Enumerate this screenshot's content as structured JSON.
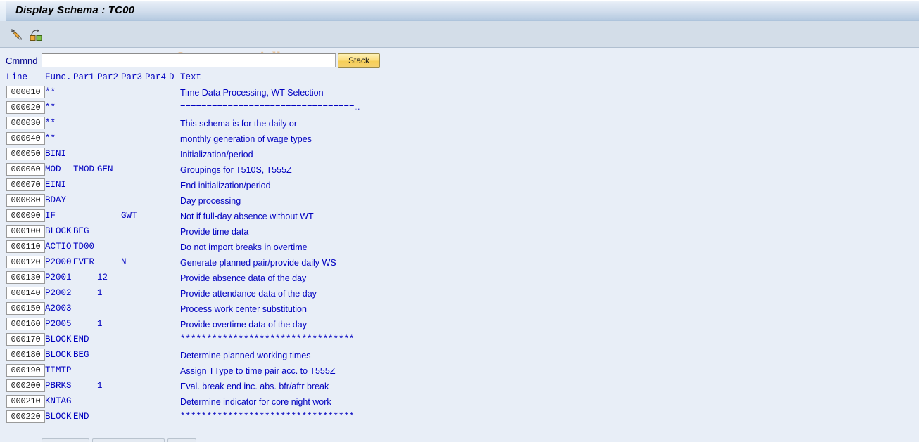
{
  "window": {
    "title": "Display Schema : TC00"
  },
  "toolbar": {
    "icons": [
      {
        "name": "edit-pencil-icon",
        "label": "Change"
      },
      {
        "name": "navigate-graph-icon",
        "label": "Display Structure"
      }
    ]
  },
  "watermark": {
    "text": "© www.tutorialkart.com",
    "color": "#e7c49c"
  },
  "command": {
    "label": "Cmmnd",
    "value": "",
    "placeholder": "",
    "stack_label": "Stack"
  },
  "columns": {
    "line": "Line",
    "func": "Func.",
    "par1": "Par1",
    "par2": "Par2",
    "par3": "Par3",
    "par4": "Par4",
    "d": "D",
    "text": "Text"
  },
  "colors": {
    "titlebar_text": "#000000",
    "grid_text": "#0000c0",
    "label_text": "#00008b",
    "line_number_text": "#222222",
    "stack_button": "#f6cf57",
    "background": "#e8eef7"
  },
  "rows": [
    {
      "line": "000010",
      "func": "**",
      "par1": "",
      "par2": "",
      "par3": "",
      "par4": "",
      "d": "",
      "text": "Time Data Processing, WT Selection",
      "mono": false
    },
    {
      "line": "000020",
      "func": "**",
      "par1": "",
      "par2": "",
      "par3": "",
      "par4": "",
      "d": "",
      "text": "=================================…",
      "mono": true
    },
    {
      "line": "000030",
      "func": "**",
      "par1": "",
      "par2": "",
      "par3": "",
      "par4": "",
      "d": "",
      "text": "This schema is for the daily or",
      "mono": false
    },
    {
      "line": "000040",
      "func": "**",
      "par1": "",
      "par2": "",
      "par3": "",
      "par4": "",
      "d": "",
      "text": "monthly generation of wage types",
      "mono": false
    },
    {
      "line": "000050",
      "func": "BINI",
      "par1": "",
      "par2": "",
      "par3": "",
      "par4": "",
      "d": "",
      "text": "Initialization/period",
      "mono": false
    },
    {
      "line": "000060",
      "func": "MOD",
      "par1": "TMOD",
      "par2": "GEN",
      "par3": "",
      "par4": "",
      "d": "",
      "text": "Groupings for T510S, T555Z",
      "mono": false
    },
    {
      "line": "000070",
      "func": "EINI",
      "par1": "",
      "par2": "",
      "par3": "",
      "par4": "",
      "d": "",
      "text": "End initialization/period",
      "mono": false
    },
    {
      "line": "000080",
      "func": "BDAY",
      "par1": "",
      "par2": "",
      "par3": "",
      "par4": "",
      "d": "",
      "text": "Day processing",
      "mono": false
    },
    {
      "line": "000090",
      "func": "IF",
      "par1": "",
      "par2": "",
      "par3": "GWT",
      "par4": "",
      "d": "",
      "text": "Not if full-day absence without WT",
      "mono": false
    },
    {
      "line": "000100",
      "func": "BLOCK",
      "par1": "BEG",
      "par2": "",
      "par3": "",
      "par4": "",
      "d": "",
      "text": "Provide time data",
      "mono": false
    },
    {
      "line": "000110",
      "func": "ACTIO",
      "par1": "TD00",
      "par2": "",
      "par3": "",
      "par4": "",
      "d": "",
      "text": "Do not import breaks in overtime",
      "mono": false
    },
    {
      "line": "000120",
      "func": "P2000",
      "par1": "EVER",
      "par2": "",
      "par3": "N",
      "par4": "",
      "d": "",
      "text": "Generate planned pair/provide daily WS",
      "mono": false
    },
    {
      "line": "000130",
      "func": "P2001",
      "par1": "",
      "par2": "12",
      "par3": "",
      "par4": "",
      "d": "",
      "text": "Provide absence data of the day",
      "mono": false
    },
    {
      "line": "000140",
      "func": "P2002",
      "par1": "",
      "par2": "1",
      "par3": "",
      "par4": "",
      "d": "",
      "text": "Provide attendance data of the day",
      "mono": false
    },
    {
      "line": "000150",
      "func": "A2003",
      "par1": "",
      "par2": "",
      "par3": "",
      "par4": "",
      "d": "",
      "text": "Process work center substitution",
      "mono": false
    },
    {
      "line": "000160",
      "func": "P2005",
      "par1": "",
      "par2": "1",
      "par3": "",
      "par4": "",
      "d": "",
      "text": "Provide overtime data of the day",
      "mono": false
    },
    {
      "line": "000170",
      "func": "BLOCK",
      "par1": "END",
      "par2": "",
      "par3": "",
      "par4": "",
      "d": "",
      "text": "*********************************",
      "mono": true
    },
    {
      "line": "000180",
      "func": "BLOCK",
      "par1": "BEG",
      "par2": "",
      "par3": "",
      "par4": "",
      "d": "",
      "text": "Determine planned working times",
      "mono": false
    },
    {
      "line": "000190",
      "func": "TIMTP",
      "par1": "",
      "par2": "",
      "par3": "",
      "par4": "",
      "d": "",
      "text": "Assign TType to time pair acc. to T555Z",
      "mono": false
    },
    {
      "line": "000200",
      "func": "PBRKS",
      "par1": "",
      "par2": "1",
      "par3": "",
      "par4": "",
      "d": "",
      "text": "Eval. break end inc. abs. bfr/aftr break",
      "mono": false
    },
    {
      "line": "000210",
      "func": "KNTAG",
      "par1": "",
      "par2": "",
      "par3": "",
      "par4": "",
      "d": "",
      "text": "Determine indicator for core night work",
      "mono": false
    },
    {
      "line": "000220",
      "func": "BLOCK",
      "par1": "END",
      "par2": "",
      "par3": "",
      "par4": "",
      "d": "",
      "text": "*********************************",
      "mono": true
    }
  ]
}
